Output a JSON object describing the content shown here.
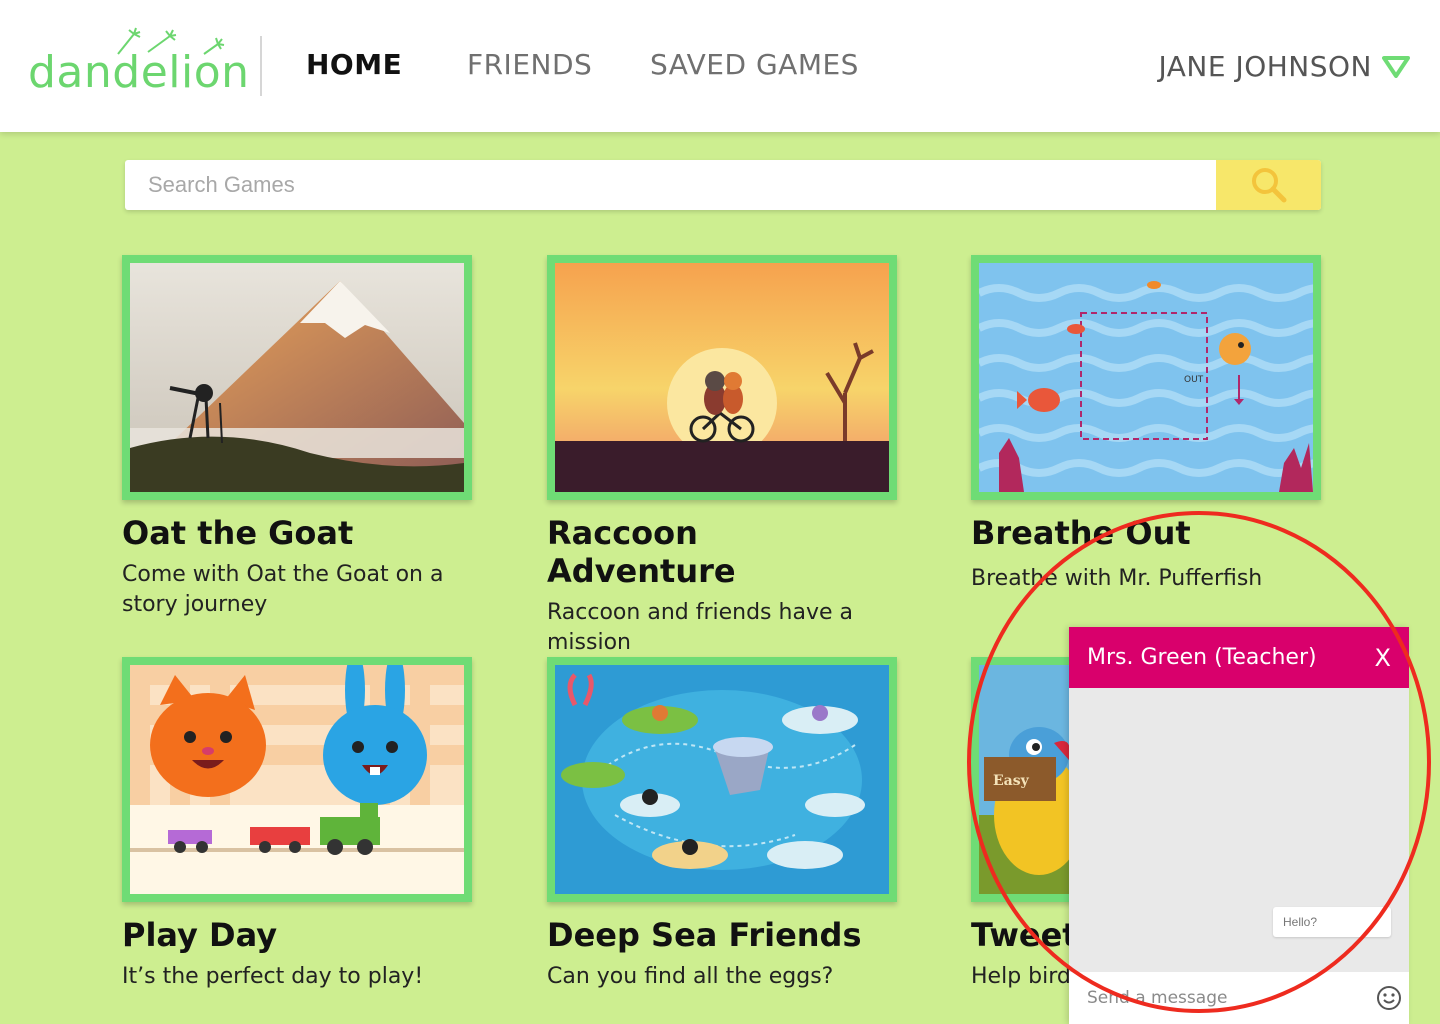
{
  "header": {
    "logo": "dandelion",
    "nav": [
      {
        "label": "HOME",
        "active": true
      },
      {
        "label": "FRIENDS",
        "active": false
      },
      {
        "label": "SAVED GAMES",
        "active": false
      }
    ],
    "user_name": "JANE JOHNSON"
  },
  "search": {
    "placeholder": "Search Games"
  },
  "games": [
    {
      "title": "Oat the Goat",
      "description": "Come with Oat the Goat on a story journey"
    },
    {
      "title": "Raccoon Adventure",
      "description": "Raccoon and friends have a mission"
    },
    {
      "title": "Breathe Out",
      "description": "Breathe with Mr. Pufferfish",
      "thumb_text": "OUT"
    },
    {
      "title": "Play Day",
      "description": "It’s the perfect day to play!"
    },
    {
      "title": "Deep Sea Friends",
      "description": "Can you find all the eggs?"
    },
    {
      "title": "Tweet",
      "description": "Help bird",
      "thumb_text": "Easy"
    }
  ],
  "chat": {
    "title": "Mrs. Green (Teacher)",
    "close_label": "X",
    "messages": [
      "Hello?"
    ],
    "input_placeholder": "Send a message"
  },
  "colors": {
    "background": "#cdee90",
    "accent_green": "#6fdc75",
    "search_button": "#f7e76a",
    "chat_header": "#d9006c",
    "annotation": "#ee2b1f"
  }
}
